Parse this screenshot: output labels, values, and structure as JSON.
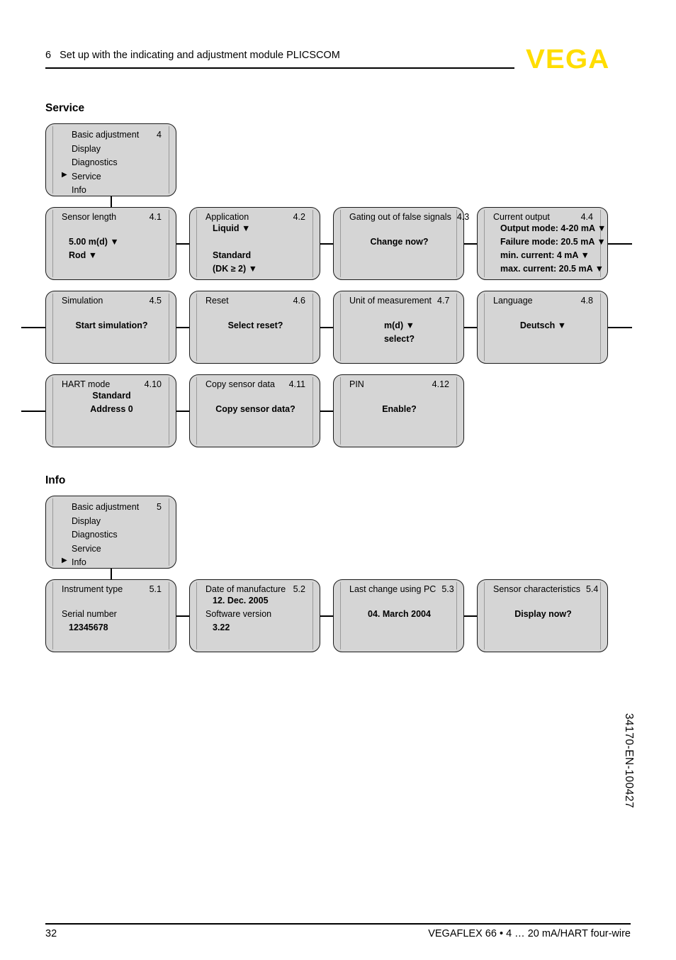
{
  "header": {
    "chapter": "6",
    "title": "Set up with the indicating and adjustment module PLICSCOM",
    "logo": "VEGA"
  },
  "sections": [
    {
      "heading": "Service",
      "menu": {
        "number": "4",
        "items": [
          {
            "label": "Basic adjustment",
            "selected": false
          },
          {
            "label": "Display",
            "selected": false
          },
          {
            "label": "Diagnostics",
            "selected": false
          },
          {
            "label": "Service",
            "selected": true
          },
          {
            "label": "Info",
            "selected": false
          }
        ]
      },
      "boxes": [
        {
          "title": "Sensor length",
          "number": "4.1",
          "lines": [
            {
              "text": "",
              "bold": false,
              "spacer": true
            },
            {
              "text": "5.00 m(d) ▼",
              "bold": true,
              "indent": true
            },
            {
              "text": "Rod ▼",
              "bold": true,
              "indent": true
            }
          ]
        },
        {
          "title": "Application",
          "number": "4.2",
          "lines": [
            {
              "text": "Liquid ▼",
              "bold": true,
              "indent": true
            },
            {
              "text": "",
              "bold": false,
              "spacer": true
            },
            {
              "text": "Standard",
              "bold": true,
              "indent": true
            },
            {
              "text": "(DK ≥ 2) ▼",
              "bold": true,
              "indent": true
            }
          ]
        },
        {
          "title": "Gating out of false signals",
          "number": "4.3",
          "lines": [
            {
              "text": "",
              "bold": false,
              "spacer": true
            },
            {
              "text": "Change now?",
              "bold": true,
              "center": true
            }
          ]
        },
        {
          "title": "Current output",
          "number": "4.4",
          "lines": [
            {
              "text": "Output mode: 4-20 mA ▼",
              "bold": true,
              "indent": true
            },
            {
              "text": "Failure mode: 20.5 mA ▼",
              "bold": true,
              "indent": true
            },
            {
              "text": "min. current: 4 mA ▼",
              "bold": true,
              "indent": true
            },
            {
              "text": "max. current: 20.5 mA ▼",
              "bold": true,
              "indent": true
            }
          ]
        },
        {
          "title": "Simulation",
          "number": "4.5",
          "lines": [
            {
              "text": "",
              "bold": false,
              "spacer": true
            },
            {
              "text": "Start simulation?",
              "bold": true,
              "center": true
            }
          ]
        },
        {
          "title": "Reset",
          "number": "4.6",
          "lines": [
            {
              "text": "",
              "bold": false,
              "spacer": true
            },
            {
              "text": "Select reset?",
              "bold": true,
              "center": true
            }
          ]
        },
        {
          "title": "Unit of measurement",
          "number": "4.7",
          "lines": [
            {
              "text": "",
              "bold": false,
              "spacer": true
            },
            {
              "text": "m(d) ▼",
              "bold": true,
              "center": true
            },
            {
              "text": "select?",
              "bold": true,
              "center": true
            }
          ]
        },
        {
          "title": "Language",
          "number": "4.8",
          "lines": [
            {
              "text": "",
              "bold": false,
              "spacer": true
            },
            {
              "text": "Deutsch ▼",
              "bold": true,
              "center": true
            }
          ]
        },
        {
          "title": "HART mode",
          "number": "4.10",
          "lines": [
            {
              "text": "Standard",
              "bold": true,
              "center": true
            },
            {
              "text": "Address 0",
              "bold": true,
              "center": true
            }
          ]
        },
        {
          "title": "Copy sensor data",
          "number": "4.11",
          "lines": [
            {
              "text": "",
              "bold": false,
              "spacer": true
            },
            {
              "text": "Copy sensor data?",
              "bold": true,
              "center": true
            }
          ]
        },
        {
          "title": "PIN",
          "number": "4.12",
          "lines": [
            {
              "text": "",
              "bold": false,
              "spacer": true
            },
            {
              "text": "Enable?",
              "bold": true,
              "center": true
            }
          ]
        }
      ]
    },
    {
      "heading": "Info",
      "menu": {
        "number": "5",
        "items": [
          {
            "label": "Basic adjustment",
            "selected": false
          },
          {
            "label": "Display",
            "selected": false
          },
          {
            "label": "Diagnostics",
            "selected": false
          },
          {
            "label": "Service",
            "selected": false
          },
          {
            "label": "Info",
            "selected": true
          }
        ]
      },
      "boxes": [
        {
          "title": "Instrument type",
          "number": "5.1",
          "lines": [
            {
              "text": "",
              "bold": false,
              "spacer": true
            },
            {
              "text": "Serial number",
              "bold": false
            },
            {
              "text": "12345678",
              "bold": true,
              "indent": true
            }
          ]
        },
        {
          "title": "Date of manufacture",
          "number": "5.2",
          "lines": [
            {
              "text": "12. Dec. 2005",
              "bold": true,
              "indent": true
            },
            {
              "text": "Software version",
              "bold": false
            },
            {
              "text": "3.22",
              "bold": true,
              "indent": true
            }
          ]
        },
        {
          "title": "Last change using PC",
          "number": "5.3",
          "lines": [
            {
              "text": "",
              "bold": false,
              "spacer": true
            },
            {
              "text": "04. March 2004",
              "bold": true,
              "center": true
            }
          ]
        },
        {
          "title": "Sensor characteristics",
          "number": "5.4",
          "lines": [
            {
              "text": "",
              "bold": false,
              "spacer": true
            },
            {
              "text": "Display now?",
              "bold": true,
              "center": true
            }
          ]
        }
      ]
    }
  ],
  "footer": {
    "page": "32",
    "product": "VEGAFLEX 66 • 4 … 20 mA/HART four-wire",
    "doc_code": "34170-EN-100427"
  },
  "icons": {
    "selected_caret": "▶",
    "dropdown_caret": "▼"
  },
  "colors": {
    "box_fill": "#d5d5d5",
    "box_border": "#1a1a1a",
    "logo": "#ffdd00"
  }
}
